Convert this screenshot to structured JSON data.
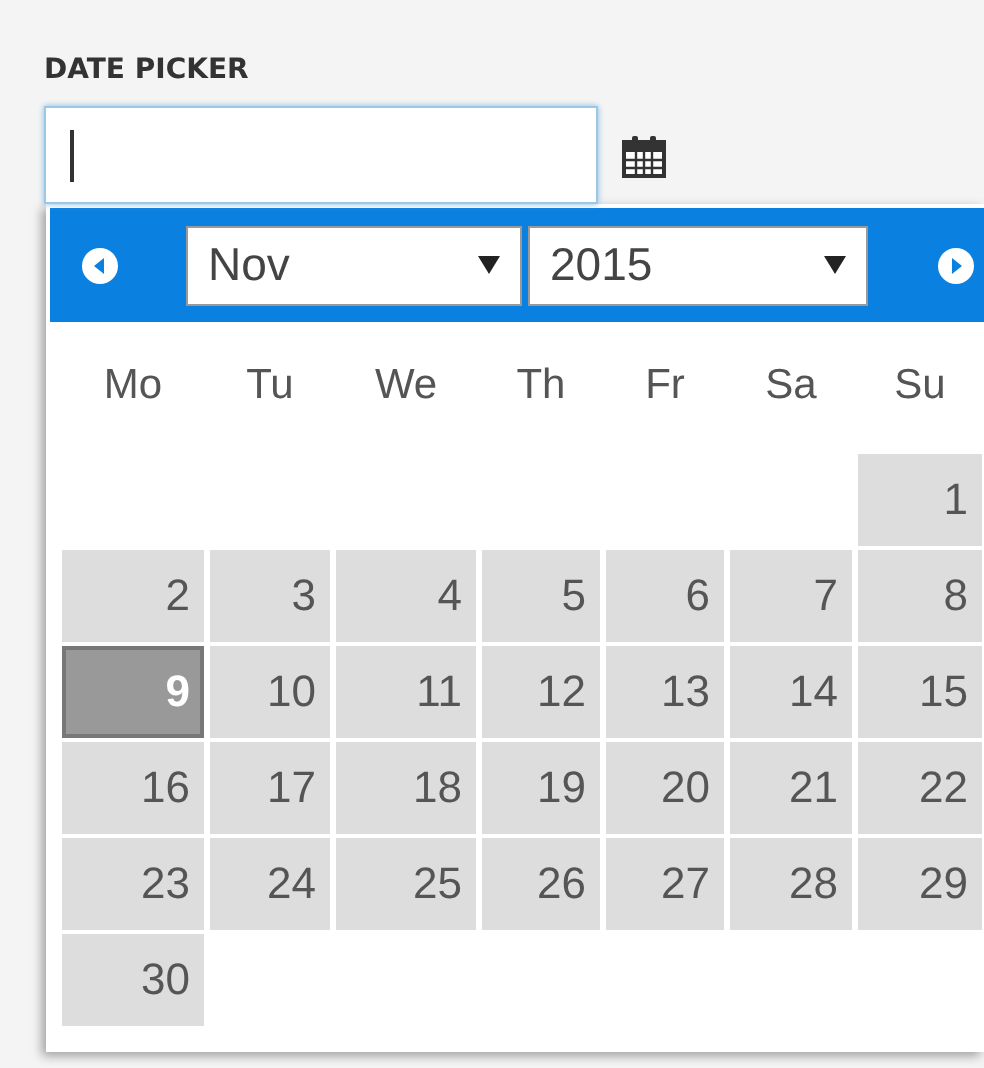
{
  "label": "DATE PICKER",
  "field": {
    "focused": true
  },
  "calendar": {
    "month": "Nov",
    "year": "2015",
    "weekdays": [
      "Mo",
      "Tu",
      "We",
      "Th",
      "Fr",
      "Sa",
      "Su"
    ],
    "weeks": [
      [
        {
          "kind": "blank"
        },
        {
          "kind": "blank"
        },
        {
          "kind": "blank"
        },
        {
          "kind": "blank"
        },
        {
          "kind": "blank"
        },
        {
          "kind": "blank"
        },
        {
          "kind": "day",
          "label": "1",
          "selected": false
        }
      ],
      [
        {
          "kind": "day",
          "label": "2",
          "selected": false
        },
        {
          "kind": "day",
          "label": "3",
          "selected": false
        },
        {
          "kind": "day",
          "label": "4",
          "selected": false
        },
        {
          "kind": "day",
          "label": "5",
          "selected": false
        },
        {
          "kind": "day",
          "label": "6",
          "selected": false
        },
        {
          "kind": "day",
          "label": "7",
          "selected": false
        },
        {
          "kind": "day",
          "label": "8",
          "selected": false
        }
      ],
      [
        {
          "kind": "day",
          "label": "9",
          "selected": true
        },
        {
          "kind": "day",
          "label": "10",
          "selected": false
        },
        {
          "kind": "day",
          "label": "11",
          "selected": false
        },
        {
          "kind": "day",
          "label": "12",
          "selected": false
        },
        {
          "kind": "day",
          "label": "13",
          "selected": false
        },
        {
          "kind": "day",
          "label": "14",
          "selected": false
        },
        {
          "kind": "day",
          "label": "15",
          "selected": false
        }
      ],
      [
        {
          "kind": "day",
          "label": "16",
          "selected": false
        },
        {
          "kind": "day",
          "label": "17",
          "selected": false
        },
        {
          "kind": "day",
          "label": "18",
          "selected": false
        },
        {
          "kind": "day",
          "label": "19",
          "selected": false
        },
        {
          "kind": "day",
          "label": "20",
          "selected": false
        },
        {
          "kind": "day",
          "label": "21",
          "selected": false
        },
        {
          "kind": "day",
          "label": "22",
          "selected": false
        }
      ],
      [
        {
          "kind": "day",
          "label": "23",
          "selected": false
        },
        {
          "kind": "day",
          "label": "24",
          "selected": false
        },
        {
          "kind": "day",
          "label": "25",
          "selected": false
        },
        {
          "kind": "day",
          "label": "26",
          "selected": false
        },
        {
          "kind": "day",
          "label": "27",
          "selected": false
        },
        {
          "kind": "day",
          "label": "28",
          "selected": false
        },
        {
          "kind": "day",
          "label": "29",
          "selected": false
        }
      ],
      [
        {
          "kind": "day",
          "label": "30",
          "selected": false
        },
        {
          "kind": "blank"
        },
        {
          "kind": "blank"
        },
        {
          "kind": "blank"
        },
        {
          "kind": "blank"
        },
        {
          "kind": "blank"
        },
        {
          "kind": "blank"
        }
      ]
    ]
  }
}
